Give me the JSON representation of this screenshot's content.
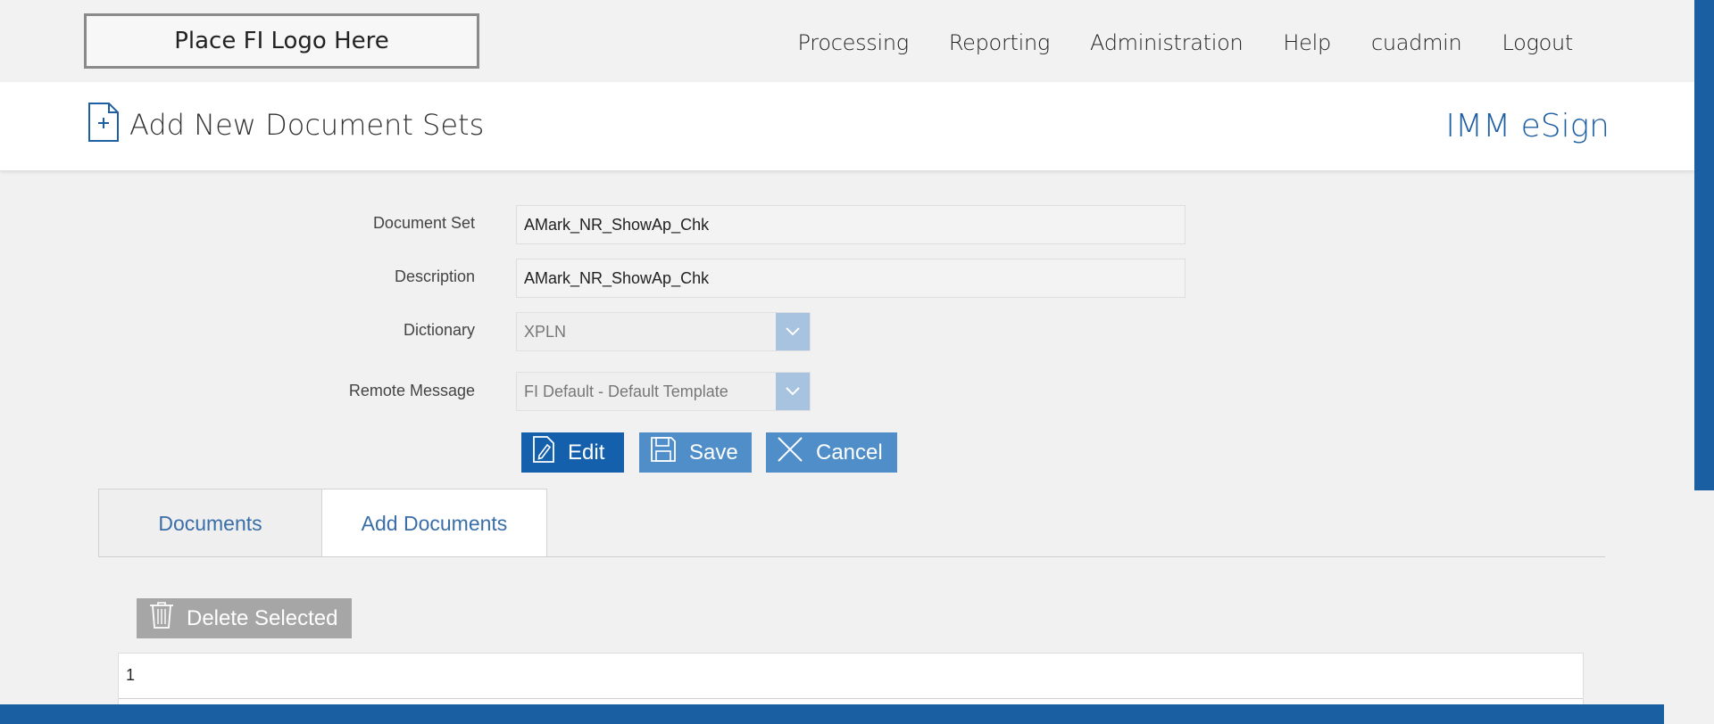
{
  "logo": {
    "text": "Place FI Logo Here"
  },
  "nav": {
    "items": [
      {
        "label": "Processing"
      },
      {
        "label": "Reporting"
      },
      {
        "label": "Administration"
      },
      {
        "label": "Help"
      },
      {
        "label": "cuadmin"
      },
      {
        "label": "Logout"
      }
    ]
  },
  "header": {
    "title": "Add New Document Sets",
    "brand": "IMM eSign"
  },
  "form": {
    "document_set": {
      "label": "Document Set",
      "value": "AMark_NR_ShowAp_Chk"
    },
    "description": {
      "label": "Description",
      "value": "AMark_NR_ShowAp_Chk"
    },
    "dictionary": {
      "label": "Dictionary",
      "value": "XPLN"
    },
    "remote_message": {
      "label": "Remote Message",
      "value": "FI Default - Default Template"
    }
  },
  "actions": {
    "edit": "Edit",
    "save": "Save",
    "cancel": "Cancel"
  },
  "tabs": [
    {
      "label": "Documents"
    },
    {
      "label": "Add Documents"
    }
  ],
  "list": {
    "delete_label": "Delete Selected",
    "rows": [
      {
        "text": "1"
      }
    ]
  },
  "colors": {
    "primary": "#1460ad",
    "secondary": "#4f8ec9",
    "brand": "#1e5fa3",
    "disabled": "#a6a6a6"
  },
  "icons": [
    "new-document-icon",
    "chevron-down-icon",
    "pencil-icon",
    "floppy-disk-icon",
    "close-icon",
    "trash-icon"
  ]
}
